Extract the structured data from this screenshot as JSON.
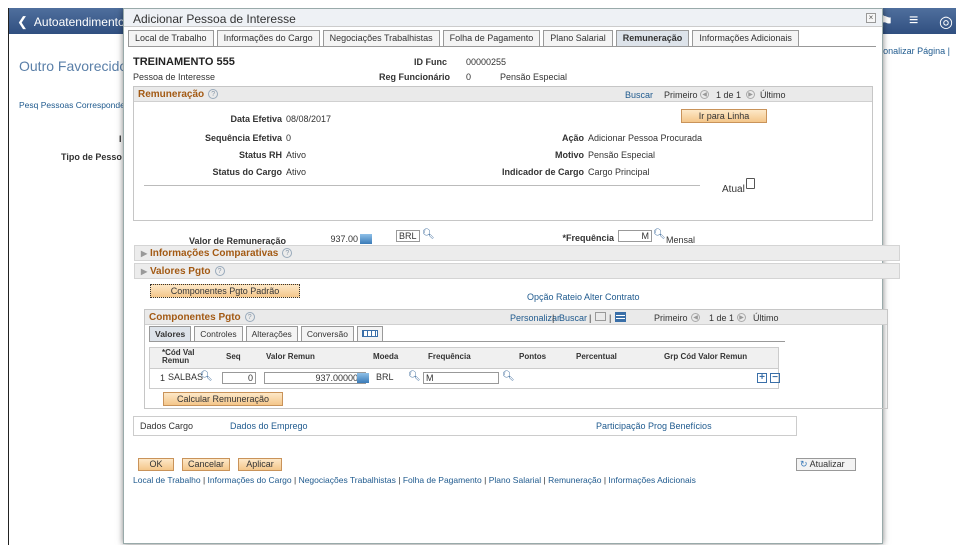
{
  "background": {
    "back_label": "Autoatendimento do Gerente",
    "personalize": "ersonalizar Página |",
    "favorites": "Outro Favorecido",
    "pesq": "Pesq Pessoas Corresponde",
    "tipo": "Tipo de Pesso",
    "i_label": "I"
  },
  "modal": {
    "title": "Adicionar Pessoa de Interesse",
    "close": "×"
  },
  "tabs": [
    {
      "label": "Local de Trabalho"
    },
    {
      "label": "Informações do Cargo"
    },
    {
      "label": "Negociações Trabalhistas"
    },
    {
      "label": "Folha de Pagamento"
    },
    {
      "label": "Plano Salarial"
    },
    {
      "label": "Remuneração"
    },
    {
      "label": "Informações Adicionais"
    }
  ],
  "employee": {
    "name": "TREINAMENTO 555",
    "role": "Pessoa de Interesse",
    "id_func_label": "ID Func",
    "id_func": "00000255",
    "reg_label": "Reg Funcionário",
    "reg": "0",
    "pension": "Pensão Especial"
  },
  "rem": {
    "title": "Remuneração",
    "buscar": "Buscar",
    "first": "Primeiro",
    "count": "1 de 1",
    "last": "Último",
    "go_line": "Ir para Linha",
    "data_efetiva_label": "Data Efetiva",
    "data_efetiva": "08/08/2017",
    "seq_label": "Sequência Efetiva",
    "seq": "0",
    "status_rh_label": "Status RH",
    "status_rh": "Ativo",
    "status_cargo_label": "Status do Cargo",
    "status_cargo": "Ativo",
    "acao_label": "Ação",
    "acao": "Adicionar Pessoa Procurada",
    "motivo_label": "Motivo",
    "motivo": "Pensão Especial",
    "indicador_label": "Indicador de Cargo",
    "indicador": "Cargo Principal",
    "atual": "Atual",
    "valor_label": "Valor de Remuneração",
    "valor": "937.00",
    "moeda": "BRL",
    "freq_label": "*Frequência",
    "freq": "M",
    "freq_desc": "Mensal"
  },
  "info_comp": "Informações Comparativas",
  "valores_pgto": "Valores Pgto",
  "comp_padrao_btn": "Componentes Pgto Padrão",
  "opcao_rateio": "Opção Rateio Alter Contrato",
  "comp": {
    "title": "Componentes Pgto",
    "personalizar": "Personalizar",
    "buscar": "Buscar",
    "first": "Primeiro",
    "count": "1 de 1",
    "last": "Último",
    "subtabs": [
      "Valores",
      "Controles",
      "Alterações",
      "Conversão"
    ],
    "headers": [
      "*Cód Val Remun",
      "Seq",
      "Valor Remun",
      "Moeda",
      "Frequência",
      "Pontos",
      "Percentual",
      "Grp Cód Valor Remun"
    ],
    "row": {
      "num": "1",
      "cod": "SALBAS",
      "seq": "0",
      "valor": "937.000000",
      "moeda": "BRL",
      "freq": "M"
    },
    "calc_btn": "Calcular Remuneração"
  },
  "links": {
    "dados_cargo": "Dados Cargo",
    "dados_emprego": "Dados do Emprego",
    "participacao": "Participação Prog Benefícios"
  },
  "buttons": {
    "ok": "OK",
    "cancelar": "Cancelar",
    "aplicar": "Aplicar",
    "atualizar": "Atualizar"
  },
  "bottom_links": [
    "Local de Trabalho",
    "Informações do Cargo",
    "Negociações Trabalhistas",
    "Folha de Pagamento",
    "Plano Salarial",
    "Remuneração",
    "Informações Adicionais"
  ]
}
